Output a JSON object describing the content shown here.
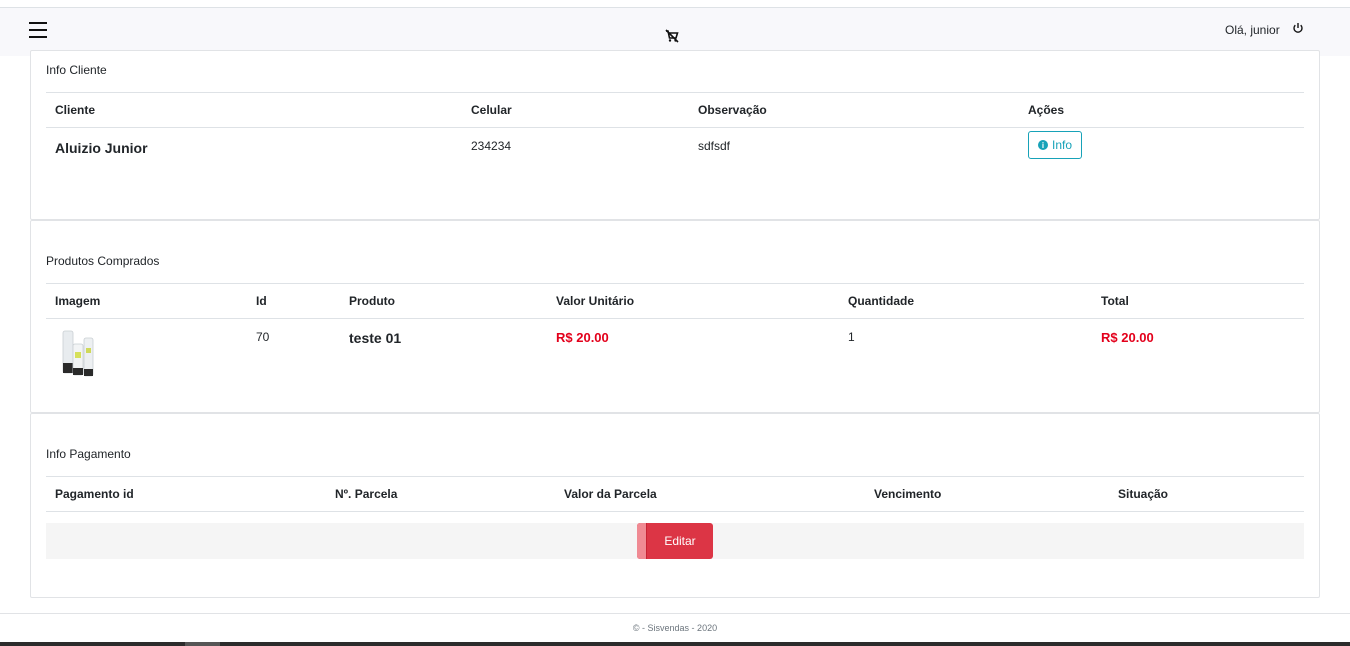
{
  "header": {
    "greeting": "Olá, junior",
    "menu_icon": "hamburger-menu-icon",
    "cart_icon": "cart-off-icon",
    "logout_icon": "power-icon"
  },
  "client_card": {
    "title": "Info Cliente",
    "columns": [
      "Cliente",
      "Celular",
      "Observação",
      "Ações"
    ],
    "row": {
      "cliente": "Aluizio Junior",
      "celular": "234234",
      "observacao": "sdfsdf",
      "info_button": "Info"
    }
  },
  "products_card": {
    "title": "Produtos Comprados",
    "columns": [
      "Imagem",
      "Id",
      "Produto",
      "Valor Unitário",
      "Quantidade",
      "Total"
    ],
    "row": {
      "id": "70",
      "produto": "teste 01",
      "valor_unitario": "R$ 20.00",
      "quantidade": "1",
      "total": "R$ 20.00"
    }
  },
  "payment_card": {
    "title": "Info Pagamento",
    "columns": [
      "Pagamento id",
      "Nº. Parcela",
      "Valor da Parcela",
      "Vencimento",
      "Situação"
    ],
    "edit_button": "Editar"
  },
  "footer": {
    "text": "© - Sisvendas - 2020"
  },
  "colors": {
    "danger": "#dc3545",
    "info": "#17a2b8",
    "price_red": "#e3001b"
  }
}
